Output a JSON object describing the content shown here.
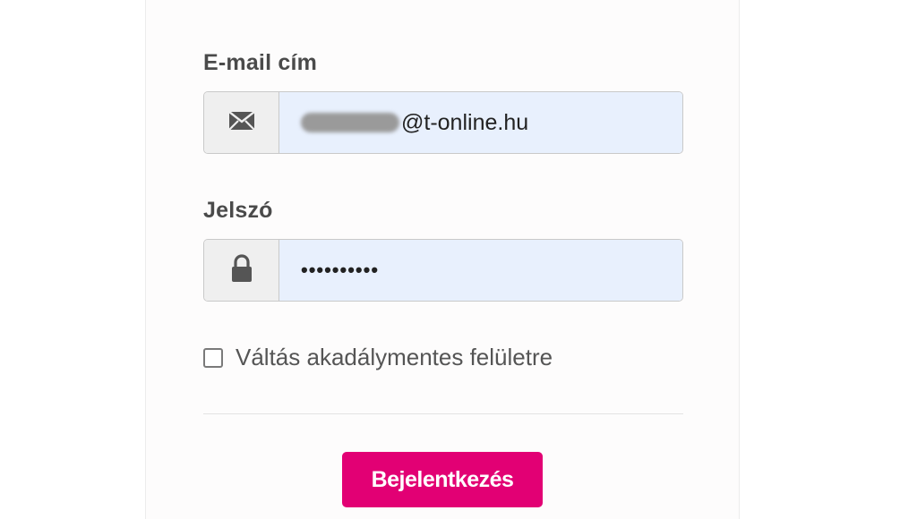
{
  "login_form": {
    "email": {
      "label": "E-mail cím",
      "value_visible": "@t-online.hu",
      "icon": "envelope-icon"
    },
    "password": {
      "label": "Jelszó",
      "masked_value": "••••••••••",
      "icon": "lock-icon"
    },
    "accessibility_toggle": {
      "label": "Váltás akadálymentes felületre",
      "checked": false
    },
    "submit_label": "Bejelentkezés"
  },
  "colors": {
    "accent": "#e20074",
    "input_background": "#e8f0fd",
    "addon_background": "#efefef",
    "label_text": "#4a4a4a"
  }
}
